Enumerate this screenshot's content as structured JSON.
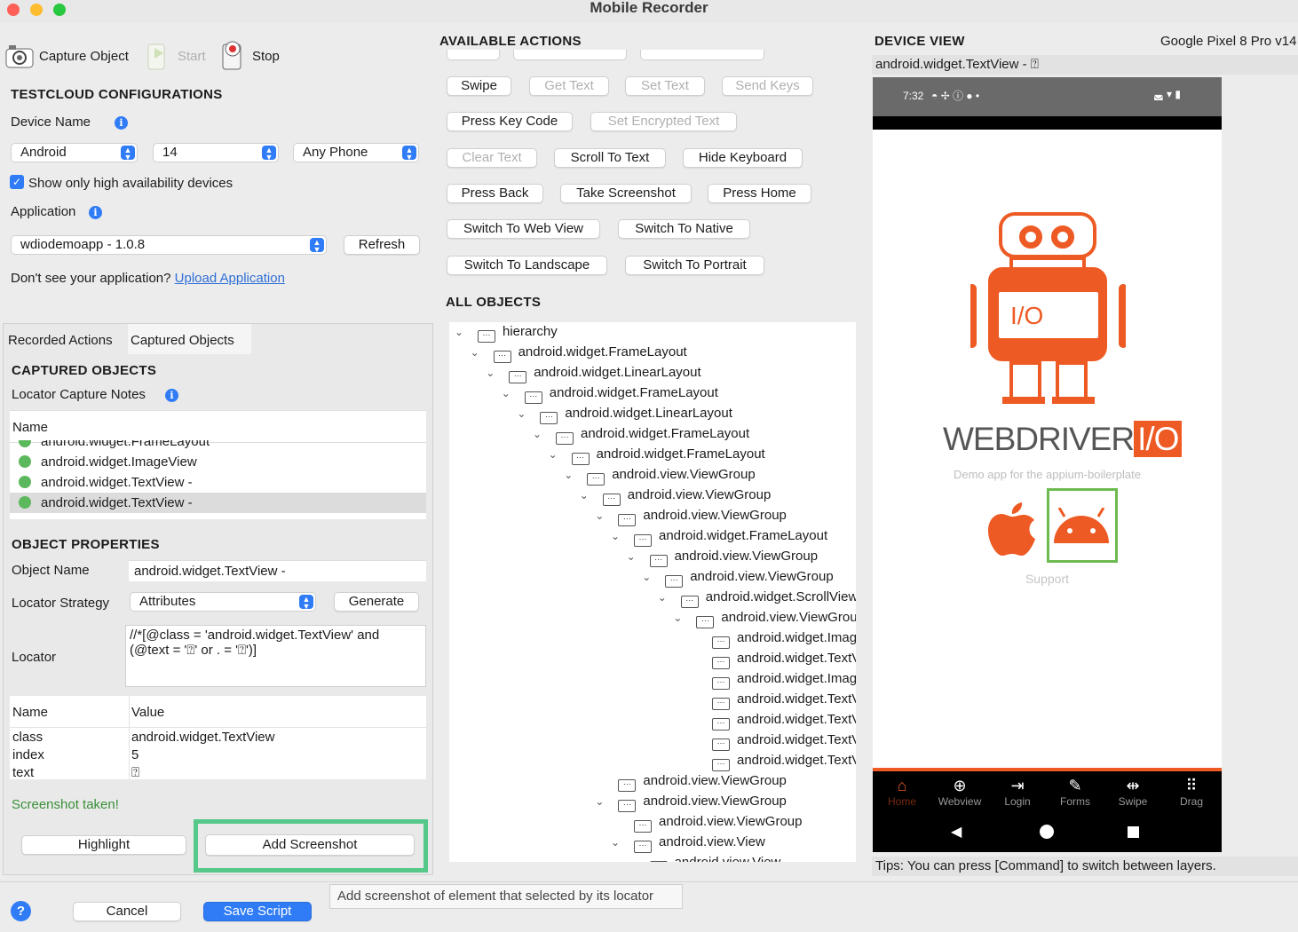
{
  "window": {
    "title": "Mobile Recorder"
  },
  "toolbar": {
    "capture": "Capture Object",
    "start": "Start",
    "stop": "Stop"
  },
  "testcloud": {
    "heading": "TESTCLOUD CONFIGURATIONS",
    "device_name_label": "Device Name",
    "os": "Android",
    "version": "14",
    "phone": "Any Phone",
    "high_avail": "Show only high availability devices",
    "application_label": "Application",
    "app": "wdiodemoapp - 1.0.8",
    "refresh": "Refresh",
    "dont_see": "Don't see your application?",
    "upload": "Upload Application"
  },
  "tabs": {
    "recorded": "Recorded Actions",
    "captured": "Captured Objects"
  },
  "captured": {
    "heading": "CAPTURED OBJECTS",
    "notes": "Locator Capture Notes",
    "col_name": "Name",
    "items": [
      "android.widget.FrameLayout",
      "android.widget.ImageView",
      "android.widget.TextView -",
      "android.widget.TextView -"
    ]
  },
  "props": {
    "heading": "OBJECT PROPERTIES",
    "object_name_label": "Object Name",
    "object_name": "android.widget.TextView -",
    "strategy_label": "Locator Strategy",
    "strategy": "Attributes",
    "generate": "Generate",
    "locator_label": "Locator",
    "locator": "//*[@class = 'android.widget.TextView' and (@text = '⍰' or . = '⍰')]",
    "col_name": "Name",
    "col_value": "Value",
    "rows": [
      {
        "k": "class",
        "v": "android.widget.TextView"
      },
      {
        "k": "index",
        "v": "5"
      },
      {
        "k": "text",
        "v": "⍰"
      }
    ],
    "status": "Screenshot taken!",
    "highlight": "Highlight",
    "add_screenshot": "Add Screenshot"
  },
  "footer": {
    "cancel": "Cancel",
    "save": "Save Script",
    "tooltip": "Add screenshot of element that selected by its locator"
  },
  "actions": {
    "heading": "AVAILABLE ACTIONS",
    "row1": [
      "Swipe",
      "Get Text",
      "Set Text",
      "Send Keys"
    ],
    "row2": [
      "Press Key Code",
      "Set Encrypted Text"
    ],
    "row3": [
      "Clear Text",
      "Scroll To Text",
      "Hide Keyboard"
    ],
    "row4": [
      "Press Back",
      "Take Screenshot",
      "Press Home"
    ],
    "row5": [
      "Switch To Web View",
      "Switch To Native"
    ],
    "row6": [
      "Switch To Landscape",
      "Switch To Portrait"
    ]
  },
  "objects": {
    "heading": "ALL OBJECTS",
    "tree": [
      {
        "t": "hierarchy",
        "d": 0,
        "e": true
      },
      {
        "t": "android.widget.FrameLayout",
        "d": 1,
        "e": true
      },
      {
        "t": "android.widget.LinearLayout",
        "d": 2,
        "e": true
      },
      {
        "t": "android.widget.FrameLayout",
        "d": 3,
        "e": true
      },
      {
        "t": "android.widget.LinearLayout",
        "d": 4,
        "e": true
      },
      {
        "t": "android.widget.FrameLayout",
        "d": 5,
        "e": true
      },
      {
        "t": "android.widget.FrameLayout",
        "d": 6,
        "e": true
      },
      {
        "t": "android.view.ViewGroup",
        "d": 7,
        "e": true
      },
      {
        "t": "android.view.ViewGroup",
        "d": 8,
        "e": true
      },
      {
        "t": "android.view.ViewGroup",
        "d": 9,
        "e": true
      },
      {
        "t": "android.widget.FrameLayout",
        "d": 10,
        "e": true
      },
      {
        "t": "android.view.ViewGroup",
        "d": 11,
        "e": true
      },
      {
        "t": "android.view.ViewGroup",
        "d": 12,
        "e": true
      },
      {
        "t": "android.widget.ScrollView",
        "d": 13,
        "e": true
      },
      {
        "t": "android.view.ViewGroup",
        "d": 14,
        "e": true
      },
      {
        "t": "android.widget.ImageView",
        "d": 15,
        "e": false
      },
      {
        "t": "android.widget.TextView",
        "d": 15,
        "e": false
      },
      {
        "t": "android.widget.ImageView",
        "d": 15,
        "e": false
      },
      {
        "t": "android.widget.TextView",
        "d": 15,
        "e": false
      },
      {
        "t": "android.widget.TextView",
        "d": 15,
        "e": false
      },
      {
        "t": "android.widget.TextView",
        "d": 15,
        "e": false
      },
      {
        "t": "android.widget.TextView",
        "d": 15,
        "e": false
      },
      {
        "t": "android.view.ViewGroup",
        "d": 9,
        "e": false
      },
      {
        "t": "android.view.ViewGroup",
        "d": 9,
        "e": true
      },
      {
        "t": "android.view.ViewGroup",
        "d": 10,
        "e": false
      },
      {
        "t": "android.view.View",
        "d": 10,
        "e": true
      },
      {
        "t": "android.view.View",
        "d": 11,
        "e": true
      }
    ]
  },
  "device": {
    "heading": "DEVICE VIEW",
    "model": "Google Pixel 8 Pro v14",
    "selected": "android.widget.TextView - ⍰",
    "time": "7:32",
    "brand": "WEBDRIVER",
    "brand_io": "I/O",
    "subtitle": "Demo app for the appium-boilerplate",
    "support": "Support",
    "nav": [
      "Home",
      "Webview",
      "Login",
      "Forms",
      "Swipe",
      "Drag"
    ],
    "tips": "Tips: You can press [Command] to switch between layers."
  }
}
